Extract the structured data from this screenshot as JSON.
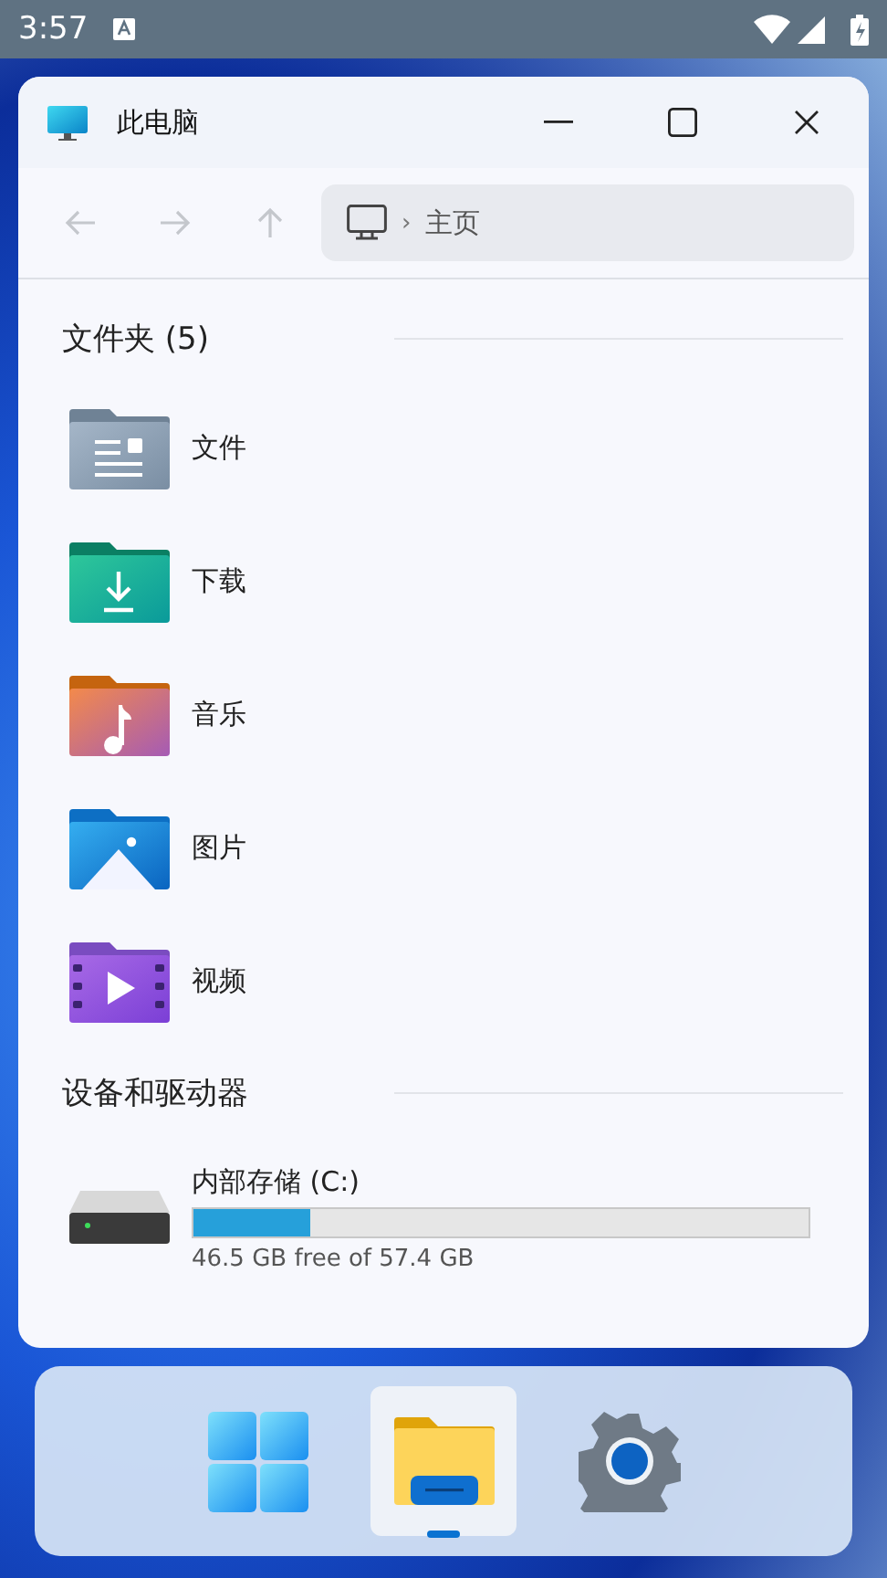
{
  "status_bar": {
    "time": "3:57"
  },
  "window": {
    "title": "此电脑"
  },
  "toolbar": {
    "nav": [
      {
        "kind": "back",
        "disabled": true
      },
      {
        "kind": "forward",
        "disabled": true
      },
      {
        "kind": "up",
        "disabled": true
      }
    ],
    "breadcrumb": {
      "separator": "›",
      "location": "主页"
    }
  },
  "sections": [
    {
      "title": "文件夹 (5)",
      "kind": "folders",
      "items": [
        {
          "name": "文件",
          "kind": "documents"
        },
        {
          "name": "下载",
          "kind": "downloads"
        },
        {
          "name": "音乐",
          "kind": "music"
        },
        {
          "name": "图片",
          "kind": "pictures"
        },
        {
          "name": "视频",
          "kind": "videos"
        }
      ]
    },
    {
      "title": "设备和驱动器",
      "kind": "drives",
      "items": [
        {
          "name": "内部存储 (C:)",
          "level": 0.19,
          "caption": "46.5 GB free of 57.4 GB"
        }
      ]
    }
  ],
  "taskbar": [
    {
      "kind": "start",
      "selected": false
    },
    {
      "kind": "explorer",
      "selected": true
    },
    {
      "kind": "settings",
      "selected": false
    }
  ]
}
